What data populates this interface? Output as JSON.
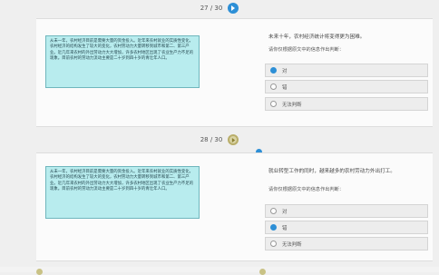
{
  "q27": {
    "pager": "27 / 30",
    "passage": "从未一年，农村经济目前是需要大量的资金投入。近年来农村就业的实质性变化，农村经济的结构发生了较大的变化，农村劳动力大量转移到城市和第二、第三产业。近几年来农村的外出劳动力大大增加，许多农村地区出现了农业生产力不足的现象。目前农村的劳动力流动主要是二十岁到四十岁的青壮年人口。",
    "stem": "未来十年，农村经济统计将变得更为困难。",
    "instruction": "请你仅根据原文中的信息作出判断：",
    "options": [
      "对",
      "错",
      "无法判断"
    ],
    "selected": 0
  },
  "q28": {
    "pager": "28 / 30",
    "passage": "从未一年，农村经济目前是需要大量的资金投入。近年来农村就业的实质性变化，农村经济的结构发生了较大的变化，农村劳动力大量转移到城市和第二、第三产业。近几年来农村的外出劳动力大大增加，许多农村地区出现了农业生产力不足的现象。目前农村的劳动力流动主要是二十岁到四十岁的青壮年人口。",
    "stem": "就业转型工作的同时，越来越多的农村劳动力外出打工。",
    "instruction": "请你仅根据原文中的信息作出判断：",
    "options": [
      "对",
      "错",
      "无法判断"
    ],
    "selected": 1
  },
  "colors": {
    "accent": "#2d8fd6",
    "passage_bg": "#b8ecee"
  }
}
